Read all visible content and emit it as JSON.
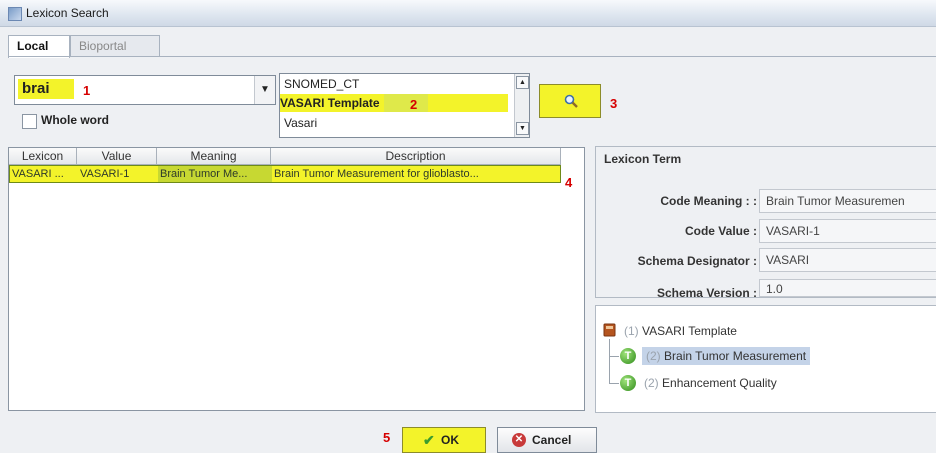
{
  "window": {
    "title": "Lexicon Search"
  },
  "tabs": [
    {
      "label": "Local"
    },
    {
      "label": "Bioportal"
    }
  ],
  "search": {
    "value": "brai",
    "whole_word_label": "Whole word"
  },
  "lexicons": [
    "SNOMED_CT",
    "VASARI Template",
    "Vasari"
  ],
  "markers": [
    "1",
    "2",
    "3",
    "4",
    "5"
  ],
  "results": {
    "columns": [
      "Lexicon",
      "Value",
      "Meaning",
      "Description"
    ],
    "rows": [
      {
        "lexicon": "VASARI ...",
        "value": "VASARI-1",
        "meaning": "Brain Tumor Me...",
        "description": "Brain Tumor Measurement for glioblasto..."
      }
    ]
  },
  "term": {
    "legend": "Lexicon Term",
    "fields": [
      {
        "label": "Code Meaning : :",
        "value": "Brain Tumor Measuremen"
      },
      {
        "label": "Code Value :",
        "value": "VASARI-1"
      },
      {
        "label": "Schema Designator :",
        "value": "VASARI"
      },
      {
        "label": "Schema Version :",
        "value": "1.0"
      }
    ]
  },
  "tree": {
    "root": {
      "num": "(1)",
      "label": "VASARI Template"
    },
    "children": [
      {
        "num": "(2)",
        "label": "Brain Tumor Measurement"
      },
      {
        "num": "(2)",
        "label": "Enhancement Quality"
      }
    ]
  },
  "buttons": {
    "ok": "OK",
    "cancel": "Cancel"
  },
  "colors": {
    "highlight": "#f3f32a",
    "marker": "#d60000"
  }
}
